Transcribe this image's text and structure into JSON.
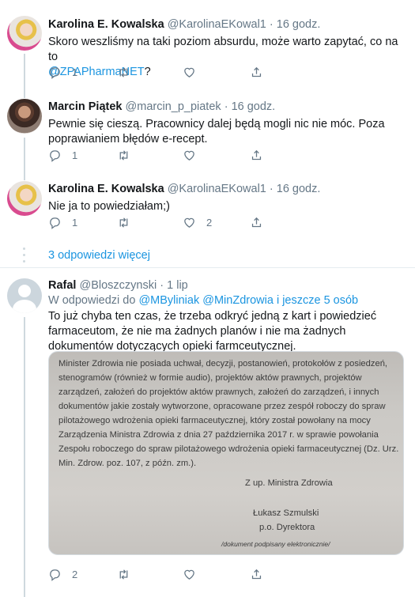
{
  "tweets": [
    {
      "name": "Karolina E. Kowalska",
      "handle": "@KarolinaEKowal1",
      "dot": "·",
      "time": "16 godz.",
      "text_before": "Skoro weszliśmy na taki poziom absurdu, może warto zapytać, co na to",
      "mention": "@ZPAPharmaNET",
      "text_after": "?",
      "reply_count": "1",
      "retweet_count": "",
      "like_count": ""
    },
    {
      "name": "Marcin Piątek",
      "handle": "@marcin_p_piatek",
      "dot": "·",
      "time": "16 godz.",
      "text": "Pewnie się cieszą. Pracownicy dalej będą mogli nic nie móc. Poza poprawianiem błędów e-recept.",
      "reply_count": "1",
      "retweet_count": "",
      "like_count": ""
    },
    {
      "name": "Karolina E. Kowalska",
      "handle": "@KarolinaEKowal1",
      "dot": "·",
      "time": "16 godz.",
      "text": "Nie ja to powiedziałam;)",
      "reply_count": "1",
      "retweet_count": "",
      "like_count": "2"
    },
    {
      "name": "Rafal",
      "handle": "@Bloszczynski",
      "dot": "·",
      "time": "1 lip",
      "reply_prefix": "W odpowiedzi do",
      "reply_mention1": "@MByliniak",
      "reply_mention2": "@MinZdrowia",
      "reply_suffix": "i jeszcze 5 osób",
      "text": "To już chyba ten czas, że trzeba odkryć jedną z kart i powiedzieć farmaceutom, że  nie ma żadnych planów i nie ma żadnych dokumentów dotyczących opieki farmceutycznej.",
      "reply_count": "2",
      "retweet_count": "",
      "like_count": ""
    }
  ],
  "more_replies": "3 odpowiedzi więcej",
  "document": {
    "lines": [
      "Minister Zdrowia nie posiada uchwał,  decyzji, postanowień, protokołów z posiedzeń,",
      "stenogramów  (również w formie audio),  projektów aktów prawnych,  projektów",
      "zarządzeń, założeń do projektów aktów prawnych, założeń do zarządzeń, i innych",
      "dokumentów jakie zostały wytworzone, opracowane przez zespół roboczy do spraw",
      "pilotażowego wdrożenia opieki farmaceutycznej, który został powołany na mocy",
      "Zarządzenia Ministra Zdrowia z dnia 27 października 2017 r. w sprawie powołania",
      "Zespołu roboczego do spraw pilotażowego wdrożenia opieki farmaceutycznej (Dz. Urz.",
      "Min. Zdrow. poz. 107, z późn. zm.)."
    ],
    "sign_role": "Z up. Ministra Zdrowia",
    "sign_name": "Łukasz Szmulski",
    "sign_title": "p.o. Dyrektora",
    "sign_note": "/dokument podpisany elektronicznie/"
  },
  "colors": {
    "accent": "#1b95e0",
    "muted": "#657786",
    "border": "#e6ecf0"
  }
}
